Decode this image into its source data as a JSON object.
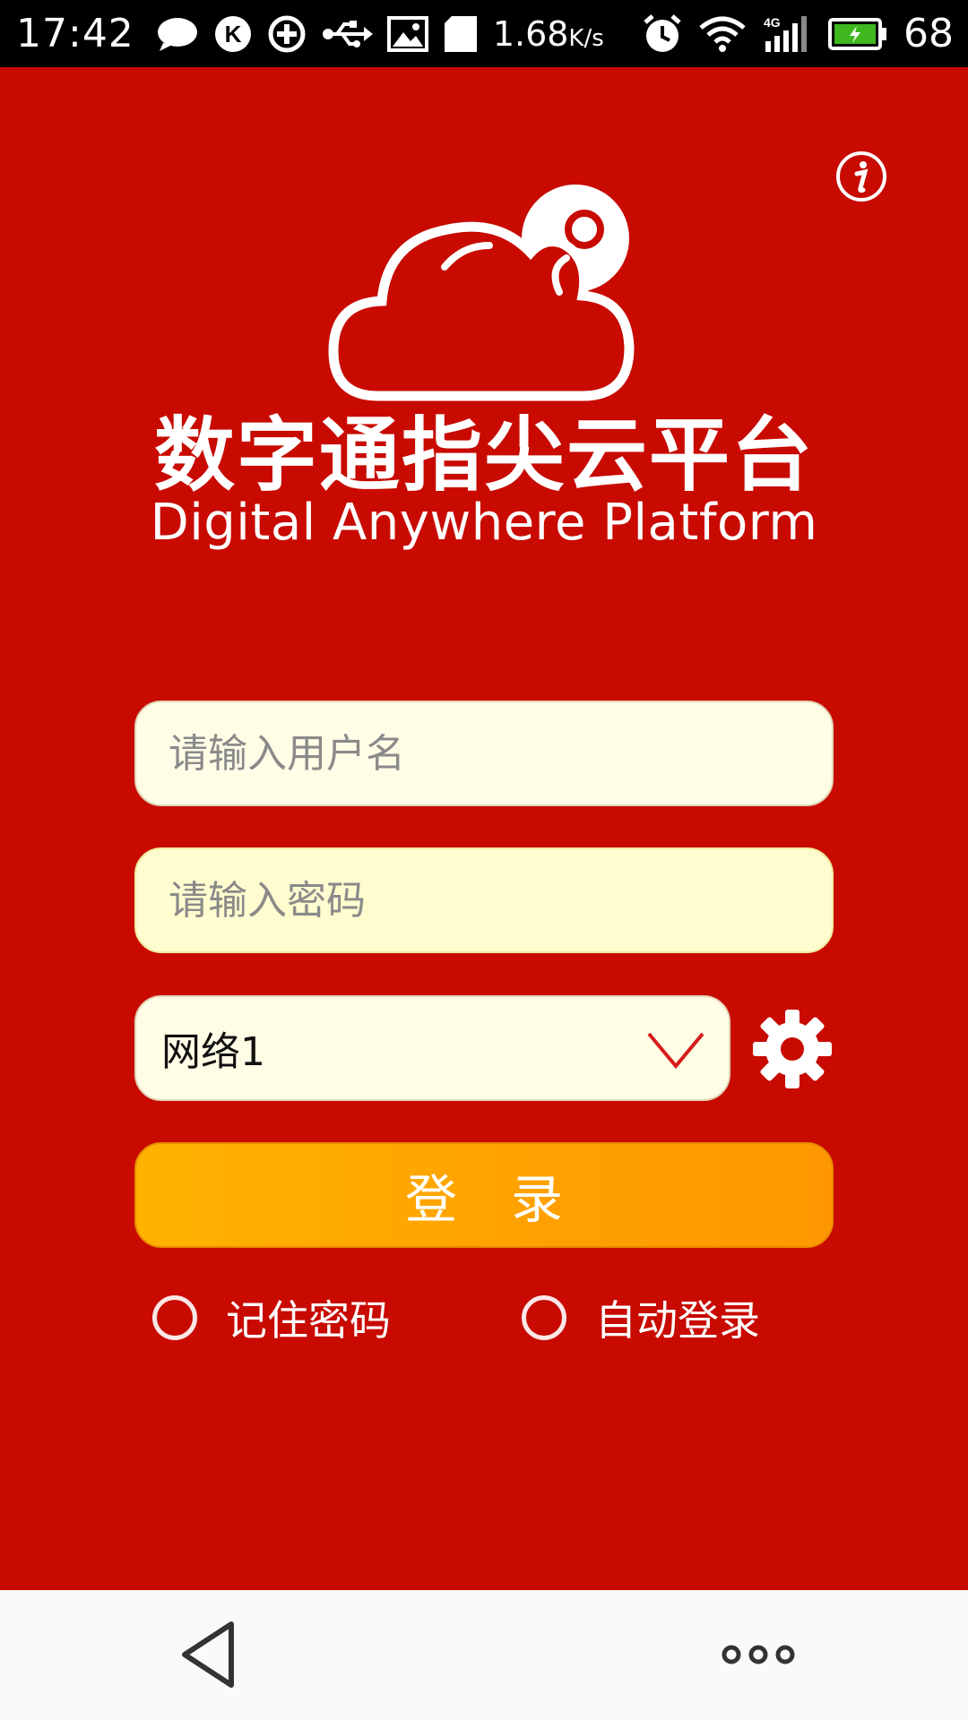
{
  "status_bar": {
    "time": "17:42",
    "net_speed_value": "1.68",
    "net_speed_unit": "K/s",
    "battery_level": "68",
    "network_type": "4G"
  },
  "app": {
    "brand_cn": "数字通指尖云平台",
    "brand_en": "Digital Anywhere Platform"
  },
  "form": {
    "username_placeholder": "请输入用户名",
    "username_value": "",
    "password_placeholder": "请输入密码",
    "password_value": "",
    "network_selected": "网络1",
    "login_label": "登录",
    "remember_label": "记住密码",
    "auto_login_label": "自动登录",
    "remember_checked": false,
    "auto_login_checked": false
  },
  "colors": {
    "background": "#c80a00",
    "field_bg": "#fffde6",
    "login_button": "#ffa000",
    "nav_bar": "#fafafa"
  },
  "icons": {
    "info": "info-icon",
    "settings": "gear-icon",
    "chevron": "chevron-down-icon",
    "back": "back-triangle-icon",
    "menu": "more-dots-icon"
  }
}
